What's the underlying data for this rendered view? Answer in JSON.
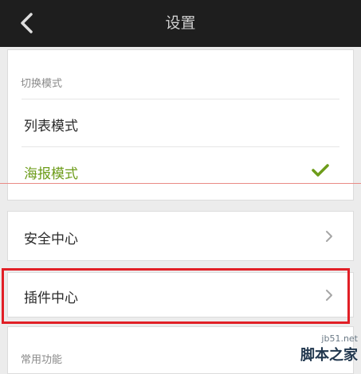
{
  "header": {
    "title": "设置",
    "back_icon": "chevron-left-icon"
  },
  "mode_section": {
    "label": "切换模式",
    "options": [
      {
        "label": "列表模式",
        "selected": false
      },
      {
        "label": "海报模式",
        "selected": true
      }
    ],
    "check_icon": "checkmark-icon"
  },
  "rows": {
    "security_center": "安全中心",
    "plugin_center": "插件中心",
    "chevron_icon": "chevron-right-icon"
  },
  "common_section": {
    "label": "常用功能"
  },
  "watermark": {
    "url": "jb51.net",
    "name": "脚本之家"
  },
  "colors": {
    "titlebar_bg": "#1e1e1e",
    "accent_green": "#6d9c1a",
    "highlight_red": "#e11f26",
    "page_bg": "#ececec"
  }
}
